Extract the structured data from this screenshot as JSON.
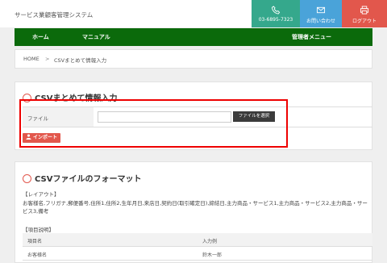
{
  "header": {
    "app_title": "サービス業顧客管理システム",
    "phone": "03-6895-7323",
    "contact_label": "お問い合わせ",
    "logout_label": "ログアウト",
    "colors": {
      "phone_bg": "#35a88c",
      "contact_bg": "#4aa3d9",
      "logout_bg": "#e2574c"
    }
  },
  "nav": {
    "items": [
      "ホーム",
      "マニュアル"
    ],
    "admin_menu": "管理者メニュー",
    "color": "#0b6a0b"
  },
  "breadcrumb": {
    "home": "HOME",
    "separator": ">",
    "current": "CSVまとめて情報入力"
  },
  "upload_section": {
    "title": "CSVまとめて情報入力",
    "field_label": "ファイル",
    "file_value": "",
    "choose_button": "ファイルを選択",
    "import_button": "インポート"
  },
  "format_section": {
    "title": "CSVファイルのフォーマット",
    "layout_heading": "【レイアウト】",
    "layout_text": "お客様名,フリガナ,郵便番号,住所1,住所2,生年月日,来店日,契約日(取引確定日),締結日,主力商品・サービス1,主力商品・サービス2,主力商品・サービス3,備考",
    "items_heading": "【項目説明】",
    "table": {
      "headers": [
        "項目名",
        "入力例"
      ],
      "rows": [
        [
          "お客様名",
          "鈴木一郎"
        ]
      ]
    }
  }
}
